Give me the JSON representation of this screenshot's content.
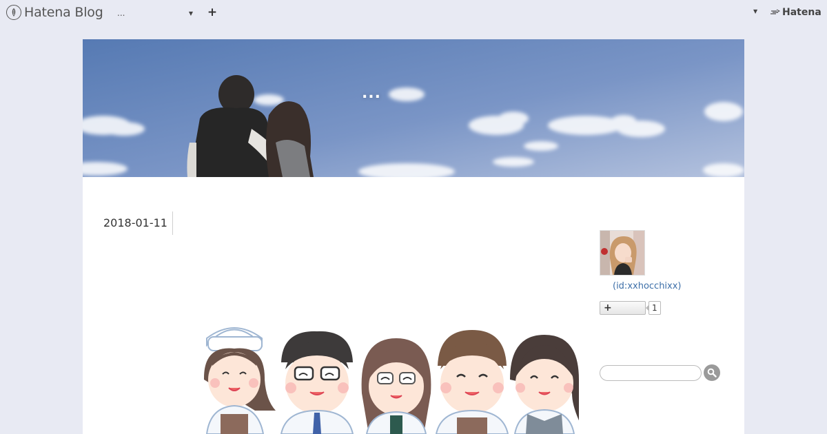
{
  "globalbar": {
    "brand": "Hatena Blog",
    "blog_select_label": "...",
    "add_label": "+",
    "hatena_logo": "Hatena"
  },
  "blog": {
    "title": "...",
    "entry_date": "2018-01-11"
  },
  "sidebar": {
    "profile_id": "(id:xxhocchixx)",
    "follow_label": "+",
    "follow_count": "1",
    "search_placeholder": ""
  },
  "colors": {
    "page_bg": "#e8eaf3",
    "link": "#3d6fa8",
    "sky_top": "#5a7bb0",
    "sky_bottom": "#a9b9d8"
  },
  "icons": {
    "brand": "hatena-pen-icon",
    "caret": "caret-down-icon",
    "add": "plus-icon",
    "search": "search-icon"
  }
}
